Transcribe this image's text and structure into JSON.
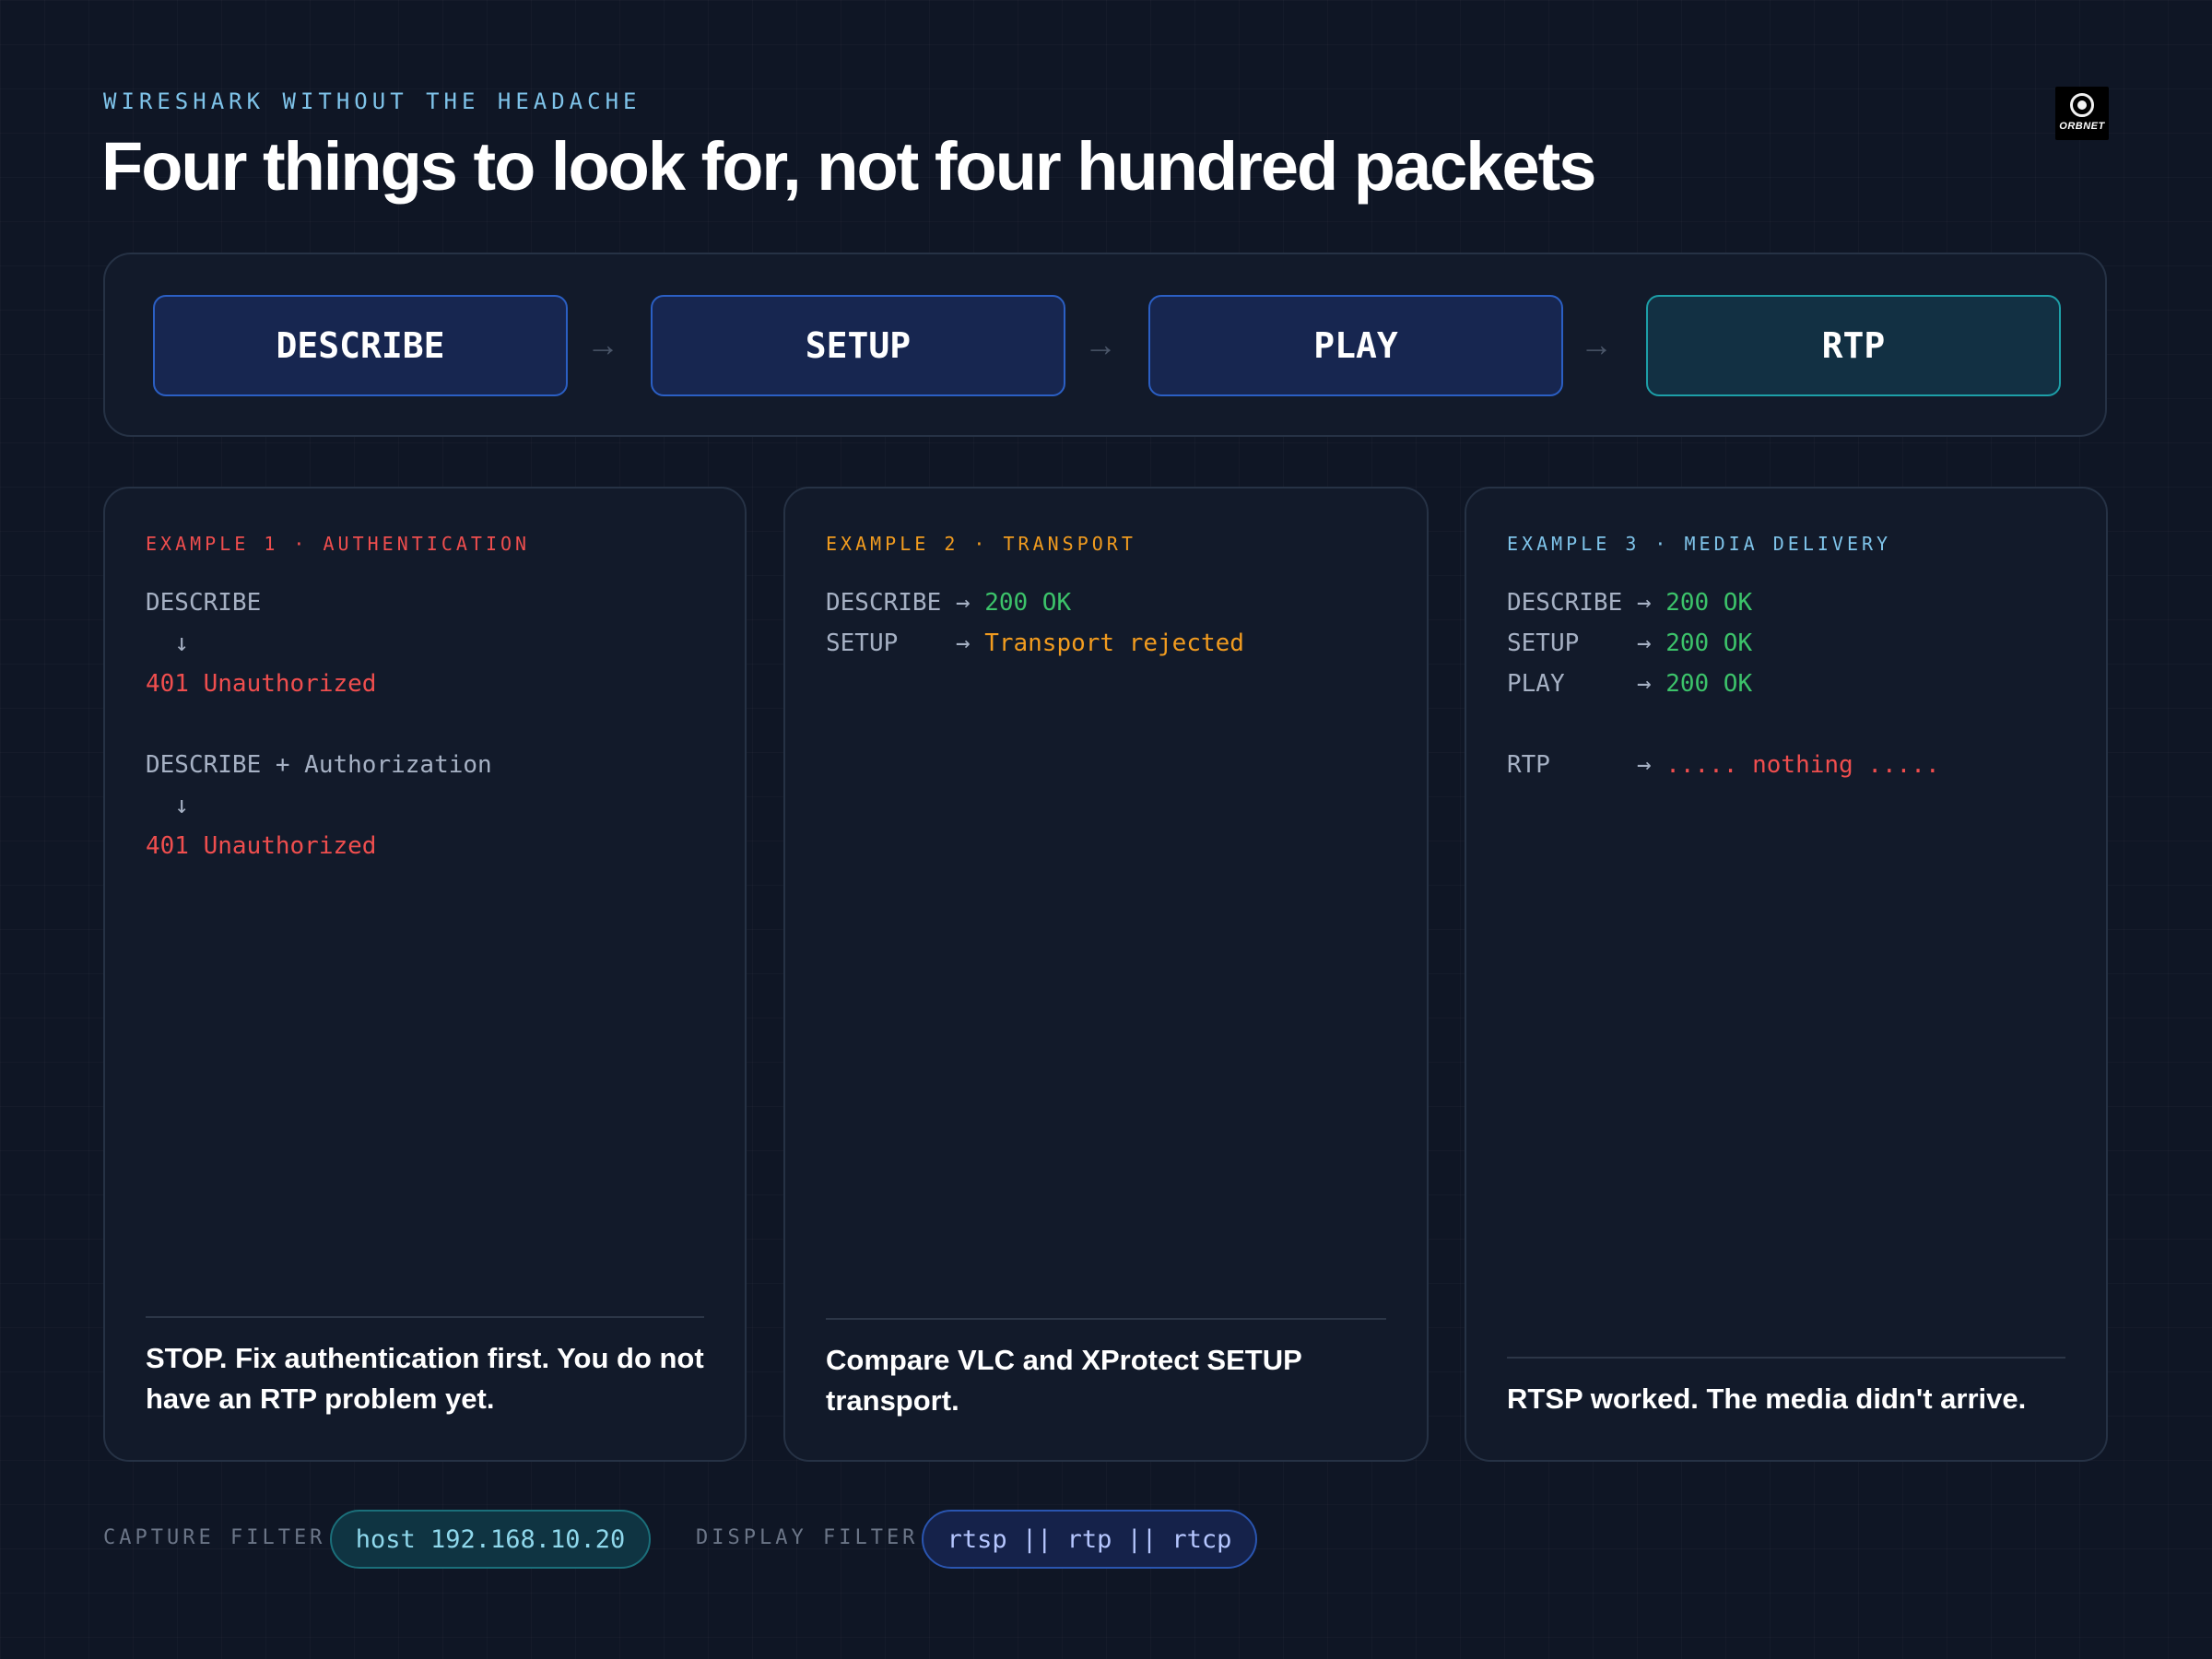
{
  "header": {
    "eyebrow": "WIRESHARK WITHOUT THE HEADACHE",
    "title": "Four things to look for, not four hundred packets",
    "logo_text": "ORBNET"
  },
  "flow": {
    "steps": [
      "DESCRIBE",
      "SETUP",
      "PLAY",
      "RTP"
    ],
    "arrow": "→"
  },
  "colors": {
    "error": "#ef4e4e",
    "ok": "#3cc36a",
    "warning": "#f29c1f",
    "accent": "#7fc4ea"
  },
  "examples": [
    {
      "label": "EXAMPLE 1 · AUTHENTICATION",
      "label_color": "#ef4e4e",
      "lines": [
        {
          "text": "DESCRIBE",
          "status": ""
        },
        {
          "text": "  ↓",
          "status": ""
        },
        {
          "text": "401 Unauthorized",
          "status": "",
          "class": "red"
        },
        {
          "text": "",
          "status": ""
        },
        {
          "text": "DESCRIBE + Authorization",
          "status": ""
        },
        {
          "text": "  ↓",
          "status": ""
        },
        {
          "text": "401 Unauthorized",
          "status": "",
          "class": "red"
        }
      ],
      "takeaway": "STOP. Fix authentication first. You do not have an RTP problem yet."
    },
    {
      "label": "EXAMPLE 2 · TRANSPORT",
      "label_color": "#f29c1f",
      "lines": [
        {
          "text": "DESCRIBE → ",
          "status": "200 OK",
          "class": "green"
        },
        {
          "text": "SETUP    → ",
          "status": "Transport rejected",
          "class": "orange"
        }
      ],
      "takeaway": "Compare VLC and XProtect SETUP transport."
    },
    {
      "label": "EXAMPLE 3 · MEDIA DELIVERY",
      "label_color": "#7fc4ea",
      "lines": [
        {
          "text": "DESCRIBE → ",
          "status": "200 OK",
          "class": "green"
        },
        {
          "text": "SETUP    → ",
          "status": "200 OK",
          "class": "green"
        },
        {
          "text": "PLAY     → ",
          "status": "200 OK",
          "class": "green"
        },
        {
          "text": "",
          "status": ""
        },
        {
          "text": "RTP      → ",
          "status": "..... nothing .....",
          "class": "red"
        }
      ],
      "takeaway": "RTSP worked. The media didn't arrive."
    }
  ],
  "filters": {
    "capture_label": "CAPTURE FILTER",
    "capture_value": "host 192.168.10.20",
    "display_label": "DISPLAY FILTER",
    "display_value": "rtsp || rtp || rtcp"
  }
}
